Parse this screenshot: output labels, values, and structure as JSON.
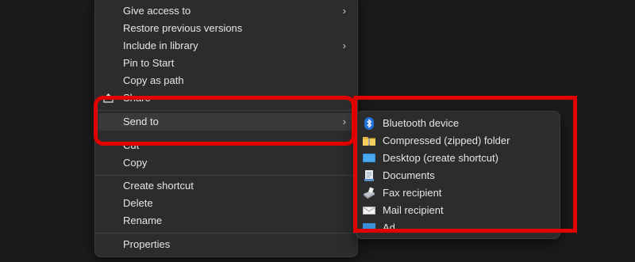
{
  "context_menu": {
    "items": [
      {
        "label": "Give access to",
        "has_submenu": true
      },
      {
        "label": "Restore previous versions",
        "has_submenu": false
      },
      {
        "label": "Include in library",
        "has_submenu": true
      },
      {
        "label": "Pin to Start",
        "has_submenu": false
      },
      {
        "label": "Copy as path",
        "has_submenu": false
      },
      {
        "label": "Share",
        "has_submenu": false
      },
      {
        "label": "Send to",
        "has_submenu": true
      },
      {
        "label": "Cut",
        "has_submenu": false
      },
      {
        "label": "Copy",
        "has_submenu": false
      },
      {
        "label": "Create shortcut",
        "has_submenu": false
      },
      {
        "label": "Delete",
        "has_submenu": false
      },
      {
        "label": "Rename",
        "has_submenu": false
      },
      {
        "label": "Properties",
        "has_submenu": false
      }
    ],
    "chevron": "›",
    "highlighted_item": "Send to"
  },
  "send_to_submenu": {
    "items": [
      {
        "label": "Bluetooth device",
        "icon": "bluetooth-icon"
      },
      {
        "label": "Compressed (zipped) folder",
        "icon": "zip-folder-icon"
      },
      {
        "label": "Desktop (create shortcut)",
        "icon": "desktop-icon"
      },
      {
        "label": "Documents",
        "icon": "documents-icon"
      },
      {
        "label": "Fax recipient",
        "icon": "fax-icon"
      },
      {
        "label": "Mail recipient",
        "icon": "mail-icon"
      },
      {
        "label": "Ad...",
        "icon": "folder-icon"
      }
    ]
  },
  "colors": {
    "highlight_box": "#e00000",
    "menu_background": "#2c2c2c",
    "page_background": "#1b1b1b"
  }
}
